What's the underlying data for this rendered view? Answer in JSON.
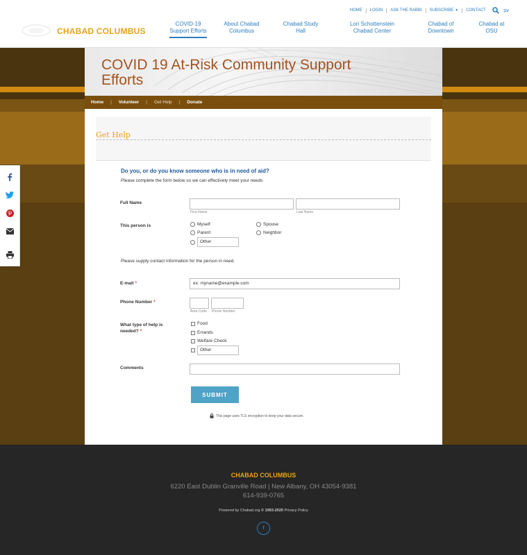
{
  "utility_nav": {
    "home": "HOME",
    "login": "LOGIN",
    "ask_rabbi": "ASK THE RABBI",
    "subscribe": "SUBSCRIBE",
    "contact": "CONTACT",
    "lang": "עִבְ"
  },
  "site": {
    "name": "CHABAD COLUMBUS",
    "brand_color": "#e8a418",
    "link_color": "#2d7dbd"
  },
  "main_nav": [
    {
      "label": "COVID-19 Support Efforts",
      "active": true
    },
    {
      "label": "About Chabad Columbus"
    },
    {
      "label": "Chabad Study Hall"
    },
    {
      "label": "Lori Schottenstein Chabad Center"
    },
    {
      "label": "Chabad of Downtown"
    },
    {
      "label": "Chabad at OSU"
    }
  ],
  "banner": {
    "title": "COVID 19 At-Risk Community Support Efforts"
  },
  "sub_nav": {
    "home": "Home",
    "volunteer": "Volunteer",
    "get_help": "Get Help",
    "donate": "Donate"
  },
  "section": {
    "title": "Get Help"
  },
  "form": {
    "heading": "Do you, or do you know someone who is in need of aid?",
    "subheading": "Please complete the form below so we can effectively meet your needs",
    "full_name": {
      "label": "Full Name",
      "first_caption": "First Name",
      "last_caption": "Last Name"
    },
    "this_person": {
      "label": "This person is",
      "options": [
        "Myself",
        "Spouse",
        "Parent",
        "Neighbor"
      ],
      "other": "Other"
    },
    "contact_note": "Please supply contact information for the person in need.",
    "email": {
      "label": "E-mail",
      "required": "*",
      "placeholder": "ex: myname@example.com"
    },
    "phone": {
      "label": "Phone Number",
      "required": "*",
      "area_caption": "Area Code",
      "number_caption": "Phone Number"
    },
    "help_type": {
      "label": "What type of help is needed?",
      "required": "*",
      "options": [
        "Food",
        "Errands",
        "Welfare Check"
      ],
      "other": "Other"
    },
    "comments": {
      "label": "Comments"
    },
    "submit": "SUBMIT",
    "secure_note": "This page uses TLS encryption to keep your data secure."
  },
  "social": [
    "facebook-icon",
    "twitter-icon",
    "pinterest-icon",
    "email-icon",
    "print-icon"
  ],
  "footer": {
    "org": "CHABAD COLUMBUS",
    "address": "6220 East Dublin Granville Road | New Albany, OH 43054-9381",
    "phone": "614-939-0765",
    "powered_prefix": "Powered by",
    "powered_link": "Chabad.org",
    "copyright": "© 1993-2020",
    "privacy": "Privacy Policy",
    "fb": "f"
  }
}
